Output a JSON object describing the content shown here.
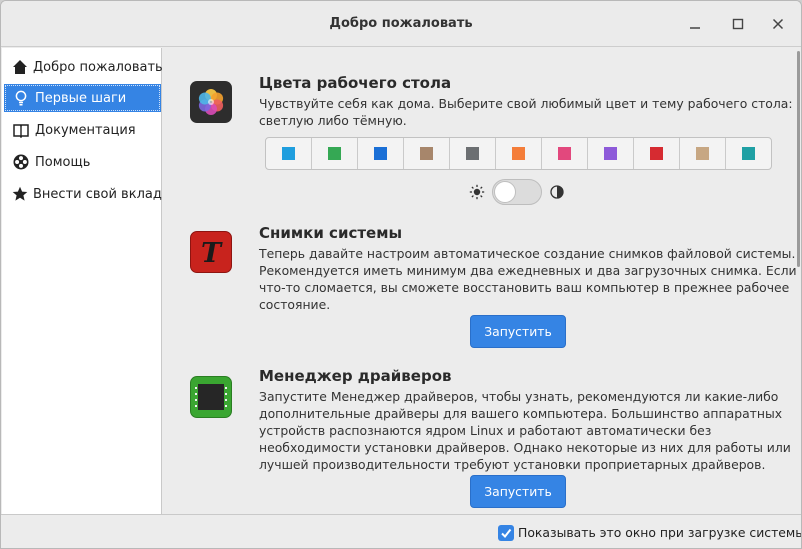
{
  "window": {
    "title": "Добро пожаловать"
  },
  "sidebar": {
    "items": [
      {
        "label": "Добро пожаловать",
        "icon": "home-icon"
      },
      {
        "label": "Первые шаги",
        "icon": "lightbulb-icon"
      },
      {
        "label": "Документация",
        "icon": "book-icon"
      },
      {
        "label": "Помощь",
        "icon": "lifebuoy-icon"
      },
      {
        "label": "Внести свой вклад",
        "icon": "star-icon"
      }
    ],
    "active_index": 1
  },
  "sections": {
    "colors": {
      "title": "Цвета рабочего стола",
      "desc": [
        "Чувствуйте себя как дома. Выберите свой любимый цвет и тему рабочего стола:",
        "светлую либо тёмную."
      ],
      "swatches": [
        "#1f9ede",
        "#35a854",
        "#1a6fd6",
        "#a7866b",
        "#6c6f72",
        "#f47d39",
        "#e2487d",
        "#8d5ad9",
        "#d62b31",
        "#c7a783",
        "#1fa0a4"
      ],
      "dark_mode": false
    },
    "snapshots": {
      "title": "Снимки системы",
      "desc": [
        "Теперь давайте настроим автоматическое создание снимков файловой системы.",
        "Рекомендуется иметь минимум два ежедневных и два загрузочных снимка. Если",
        "что-то сломается, вы сможете восстановить ваш компьютер в прежнее рабочее",
        "состояние."
      ],
      "button": "Запустить"
    },
    "drivers": {
      "title": "Менеджер драйверов",
      "desc": [
        "Запустите Менеджер драйверов, чтобы узнать, рекомендуются ли какие-либо",
        "дополнительные драйверы для вашего компьютера. Большинство аппаратных",
        "устройств распознаются ядром Linux и работают автоматически без",
        "необходимости установки драйверов. Однако некоторые из них для работы или",
        "лучшей производительности требуют установки проприетарных драйверов."
      ],
      "button": "Запустить"
    }
  },
  "footer": {
    "checkbox_label": "Показывать это окно при загрузке системы",
    "checked": true
  }
}
